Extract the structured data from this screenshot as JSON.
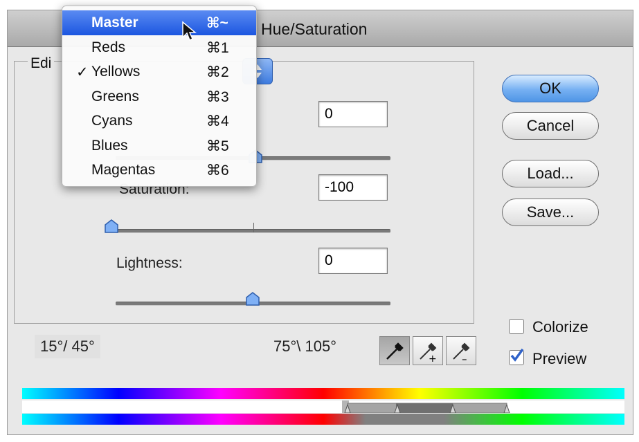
{
  "window": {
    "title": "Hue/Saturation"
  },
  "edit": {
    "label": "Edi"
  },
  "menu": {
    "items": [
      {
        "label": "Master",
        "shortcut": "⌘~",
        "checked": false,
        "highlighted": true
      },
      {
        "label": "Reds",
        "shortcut": "⌘1",
        "checked": false,
        "highlighted": false
      },
      {
        "label": "Yellows",
        "shortcut": "⌘2",
        "checked": true,
        "highlighted": false
      },
      {
        "label": "Greens",
        "shortcut": "⌘3",
        "checked": false,
        "highlighted": false
      },
      {
        "label": "Cyans",
        "shortcut": "⌘4",
        "checked": false,
        "highlighted": false
      },
      {
        "label": "Blues",
        "shortcut": "⌘5",
        "checked": false,
        "highlighted": false
      },
      {
        "label": "Magentas",
        "shortcut": "⌘6",
        "checked": false,
        "highlighted": false
      }
    ],
    "check_glyph": "✓"
  },
  "hue": {
    "value": "0"
  },
  "saturation": {
    "label": "Saturation:",
    "value": "-100"
  },
  "lightness": {
    "label": "Lightness:",
    "value": "0"
  },
  "buttons": {
    "ok": "OK",
    "cancel": "Cancel",
    "load": "Load...",
    "save": "Save..."
  },
  "options": {
    "colorize": {
      "label": "Colorize",
      "checked": false
    },
    "preview": {
      "label": "Preview",
      "checked": true
    }
  },
  "range": {
    "left": "15°/ 45°",
    "right": "75°\\ 105°"
  },
  "icons": [
    "eyedropper-icon",
    "eyedropper-plus-icon",
    "eyedropper-minus-icon",
    "pointer-cursor-icon"
  ],
  "colors": {
    "accent": "#1c56e0",
    "default_button": "#76b0f2",
    "check": "#2f62c9"
  }
}
